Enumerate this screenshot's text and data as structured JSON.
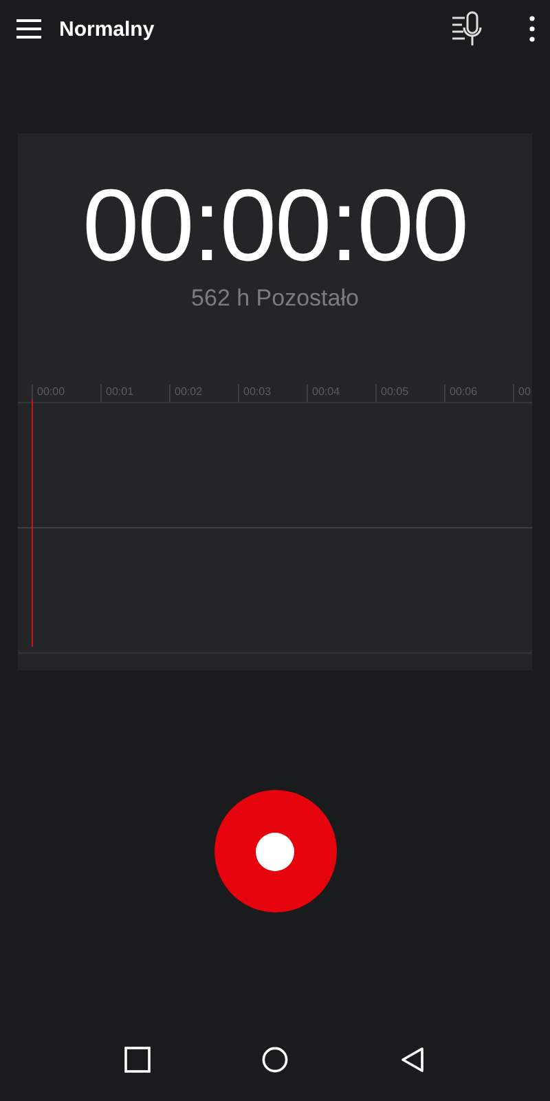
{
  "top_bar": {
    "title": "Normalny"
  },
  "timer": {
    "time": "00:00:00",
    "remaining": "562 h Pozostało"
  },
  "timeline": {
    "ticks": [
      "00:00",
      "00:01",
      "00:02",
      "00:03",
      "00:04",
      "00:05",
      "00:06",
      "00"
    ]
  }
}
